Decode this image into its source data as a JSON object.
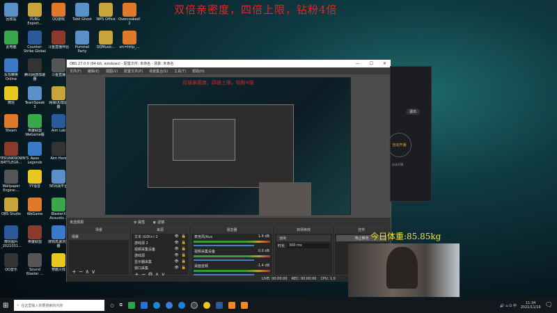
{
  "banner": "双倍亲密度，四倍上限，钻粉4倍",
  "desktop_icons": [
    "回收站",
    "PUBG Export...",
    "QQ游戏",
    "此电脑",
    "Counter-Strike Global Off...",
    "斗鱼直播伴侣",
    "反恐精英Online",
    "腾讯网游加速器",
    "斗鱼直播",
    "微信",
    "TeamSpeak 3",
    "网易UU加速器",
    "Steam",
    "英雄联盟WeGame版",
    "Aim Lab",
    "PLAYERUNKNOWN'S BATTLEGR...",
    "Apex Legends",
    "Aim Hero",
    "Wallpaper Engine:...",
    "YY语音",
    "5E对战平台",
    "OBS Studio",
    "WeGame",
    "BlasterX Acoustic...",
    "微信图片_2021031...",
    "英雄联盟",
    "搜狗高速浏览器",
    "QQ音乐",
    "Sound Blaster ...",
    "穿越火线"
  ],
  "top_icons": [
    "Tobii Ghost",
    "WPS Office",
    "Overcooked! 2"
  ],
  "row2_icons": [
    "Pummel Party",
    "QQMusic...",
    "src=http_..."
  ],
  "obs": {
    "title": "OBS 27.0.0 (64-bit, windows) - 配置文件: 未命名 - 场景: 未命名",
    "menu": [
      "文件(F)",
      "编辑(E)",
      "视图(V)",
      "配置文件(P)",
      "场景集合(S)",
      "工具(T)",
      "帮助(H)"
    ],
    "no_source": "未选择源",
    "properties": "属性",
    "filters": "滤镜",
    "docks": {
      "scenes": "场景",
      "sources": "来源",
      "mixer": "混音器",
      "transitions": "转场特效",
      "controls": "控件"
    },
    "scene_items": [
      "场景"
    ],
    "sources": [
      "文本 (GDI+) 2",
      "游戏源 2",
      "视频采集设备",
      "游戏源",
      "显示器采集",
      "窗口采集"
    ],
    "mixer": [
      {
        "name": "麦克风/Aux",
        "db": "1.6 dB"
      },
      {
        "name": "视频采集设备",
        "db": "0.0 dB"
      },
      {
        "name": "桌面音频",
        "db": "-1.4 dB"
      }
    ],
    "transition": "淡出",
    "duration_label": "时长",
    "duration": "300 ms",
    "control_stop": "停止推流",
    "status": {
      "live": "LIVE: 00:00:00",
      "rec": "REC: 00:00:00",
      "cpu": "CPU: 1.0"
    }
  },
  "side_app": {
    "exit": "退出",
    "auto": "自动开播",
    "note": "自动开播"
  },
  "weight": "今日体重:85.85kg",
  "taskbar": {
    "search_placeholder": "在这里输入你要搜索的内容",
    "time": "11:34",
    "date": "2021/11/19"
  }
}
